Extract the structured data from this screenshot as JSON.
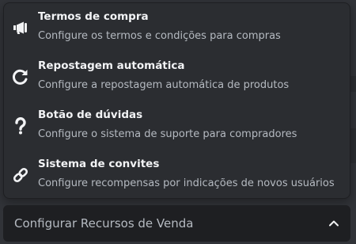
{
  "menu": {
    "items": [
      {
        "title": "Termos de compra",
        "description": "Configure os termos e condições para compras",
        "icon": "megaphone-icon"
      },
      {
        "title": "Repostagem automática",
        "description": "Configure a repostagem automática de produtos",
        "icon": "refresh-icon"
      },
      {
        "title": "Botão de dúvidas",
        "description": "Configure o sistema de suporte para compradores",
        "icon": "question-mark-icon"
      },
      {
        "title": "Sistema de convites",
        "description": "Configure recompensas por indicações de novos usuários",
        "icon": "link-icon"
      }
    ]
  },
  "select": {
    "label": "Configurar Recursos de Venda",
    "state": "expanded",
    "icon": "chevron-up-icon"
  },
  "colors": {
    "background": "#313338",
    "menu_bg": "#2b2d31",
    "select_bg": "#1e1f22",
    "title_text": "#f2f3f5",
    "description_text": "#b5bac1"
  }
}
